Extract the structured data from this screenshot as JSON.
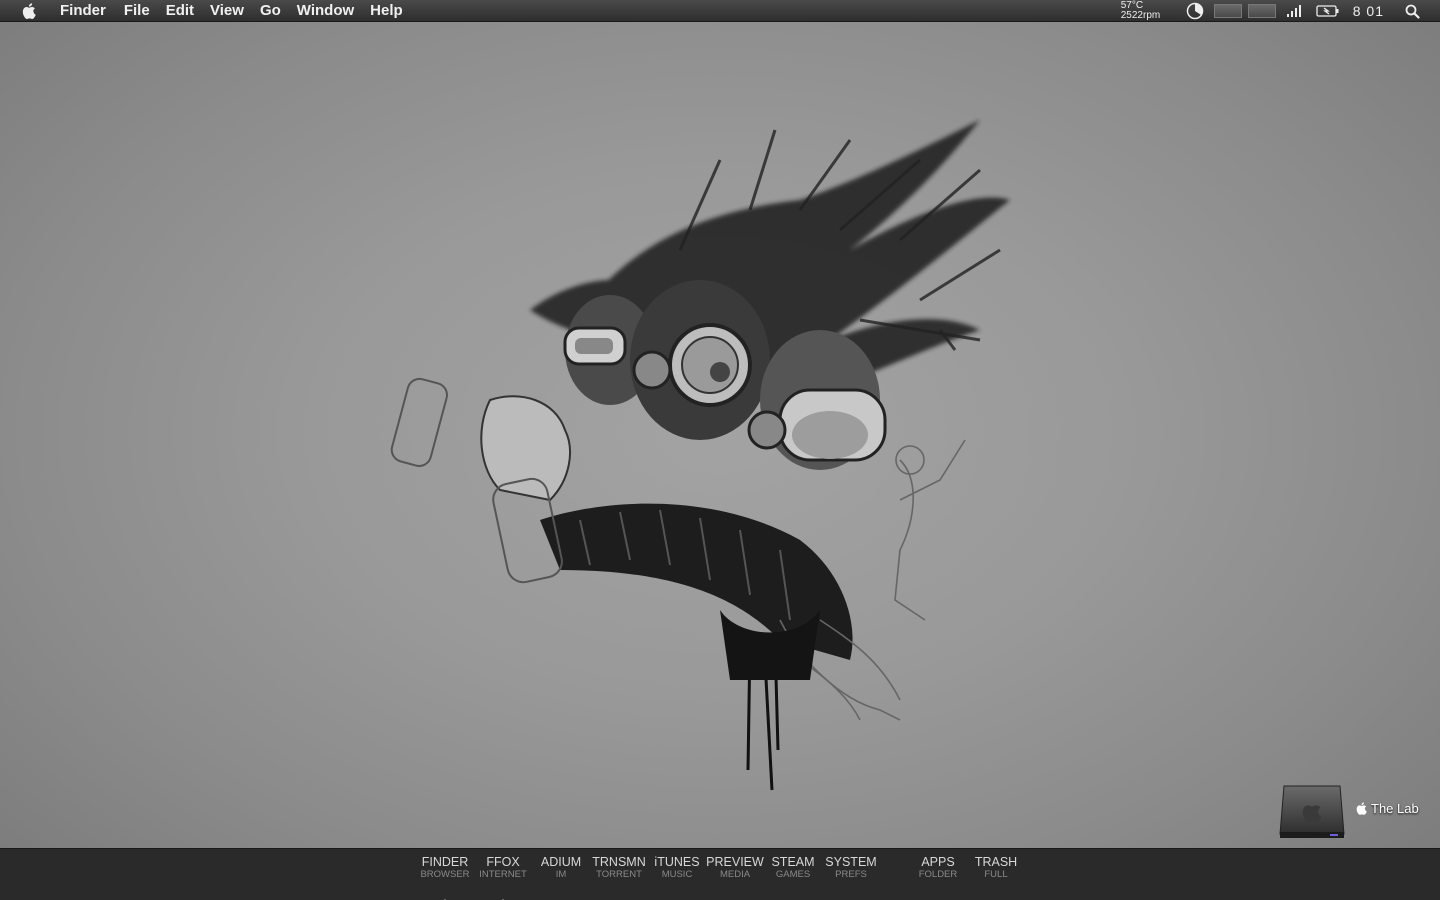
{
  "menubar": {
    "app_name": "Finder",
    "items": [
      "File",
      "Edit",
      "View",
      "Go",
      "Window",
      "Help"
    ],
    "status": {
      "temperature": "57°C",
      "fan": "2522rpm",
      "clock": "8 01",
      "icons": [
        "time-machine-icon",
        "cpu-meter-icon",
        "memory-meter-icon",
        "wifi-icon",
        "battery-icon",
        "spotlight-icon"
      ]
    }
  },
  "desktop": {
    "drive_label": "The Lab",
    "drive_icon": "hard-drive-icon"
  },
  "dock": {
    "items": [
      {
        "title": "FINDER",
        "sub": "BROWSER",
        "running": true
      },
      {
        "title": "FFOX",
        "sub": "INTERNET",
        "running": true
      },
      {
        "title": "ADIUM",
        "sub": "IM",
        "running": false
      },
      {
        "title": "TRNSMN",
        "sub": "TORRENT",
        "running": false
      },
      {
        "title": "iTUNES",
        "sub": "MUSIC",
        "running": false
      },
      {
        "title": "PREVIEW",
        "sub": "MEDIA",
        "running": false
      },
      {
        "title": "STEAM",
        "sub": "GAMES",
        "running": false
      },
      {
        "title": "SYSTEM",
        "sub": "PREFS",
        "running": false
      },
      {
        "title": "APPS",
        "sub": "FOLDER",
        "running": false
      },
      {
        "title": "TRASH",
        "sub": "FULL",
        "running": false
      }
    ]
  },
  "colors": {
    "menubar": "#3a3a3a",
    "dock": "#2a2a2a",
    "wallpaper": "#9a9a9a"
  }
}
